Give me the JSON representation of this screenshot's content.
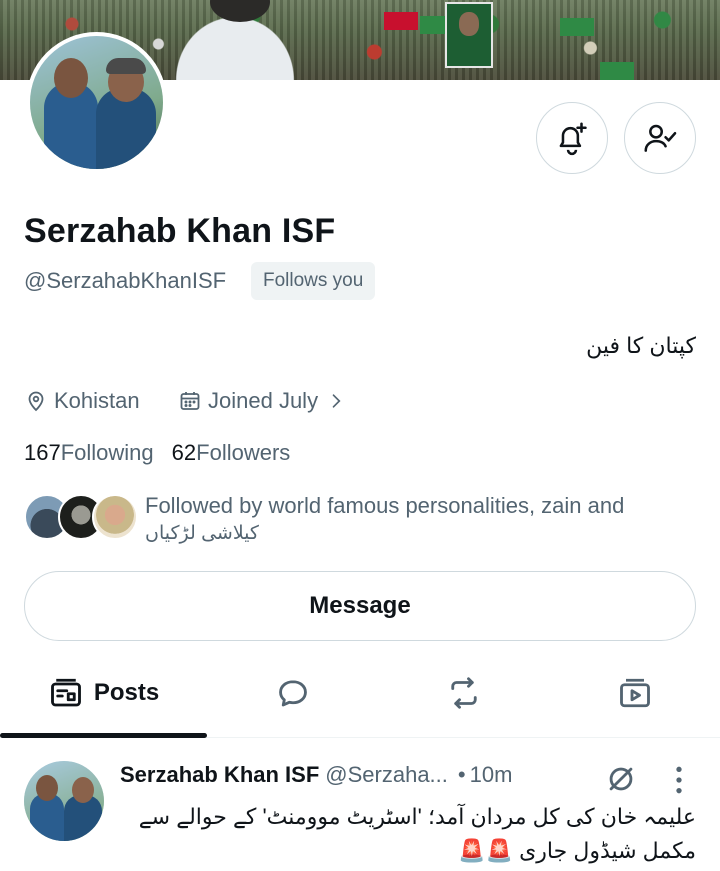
{
  "profile": {
    "name": "Serzahab Khan ISF",
    "handle": "@SerzahabKhanISF",
    "follows_you": "Follows you",
    "bio": "کپتان کا فین",
    "location": "Kohistan",
    "joined": "Joined July",
    "following_count": "167",
    "following_label": "Following",
    "followers_count": "62",
    "followers_label": "Followers",
    "followed_by_line1": "Followed by world famous personalities, zain and",
    "followed_by_line2": "کیلاشی لڑکیاں"
  },
  "actions": {
    "notify_icon": "bell-plus-icon",
    "following_icon": "person-check-icon",
    "message_label": "Message"
  },
  "tabs": [
    {
      "label": "Posts",
      "icon": "posts-icon",
      "active": true
    },
    {
      "label": "",
      "icon": "reply-bubble-icon",
      "active": false
    },
    {
      "label": "",
      "icon": "repost-icon",
      "active": false
    },
    {
      "label": "",
      "icon": "media-play-icon",
      "active": false
    }
  ],
  "post": {
    "name": "Serzahab Khan ISF",
    "handle": "@Serzaha...",
    "dot": "•",
    "time": "10m",
    "text": "علیمہ خان کی کل مردان آمد؛ 'اسٹریٹ موومنٹ' کے حوالے سے مکمل شیڈول جاری 🚨🚨"
  },
  "colors": {
    "text_primary": "#0f1419",
    "text_secondary": "#536471",
    "border": "#cfd9de",
    "badge_bg": "#eff3f4"
  }
}
